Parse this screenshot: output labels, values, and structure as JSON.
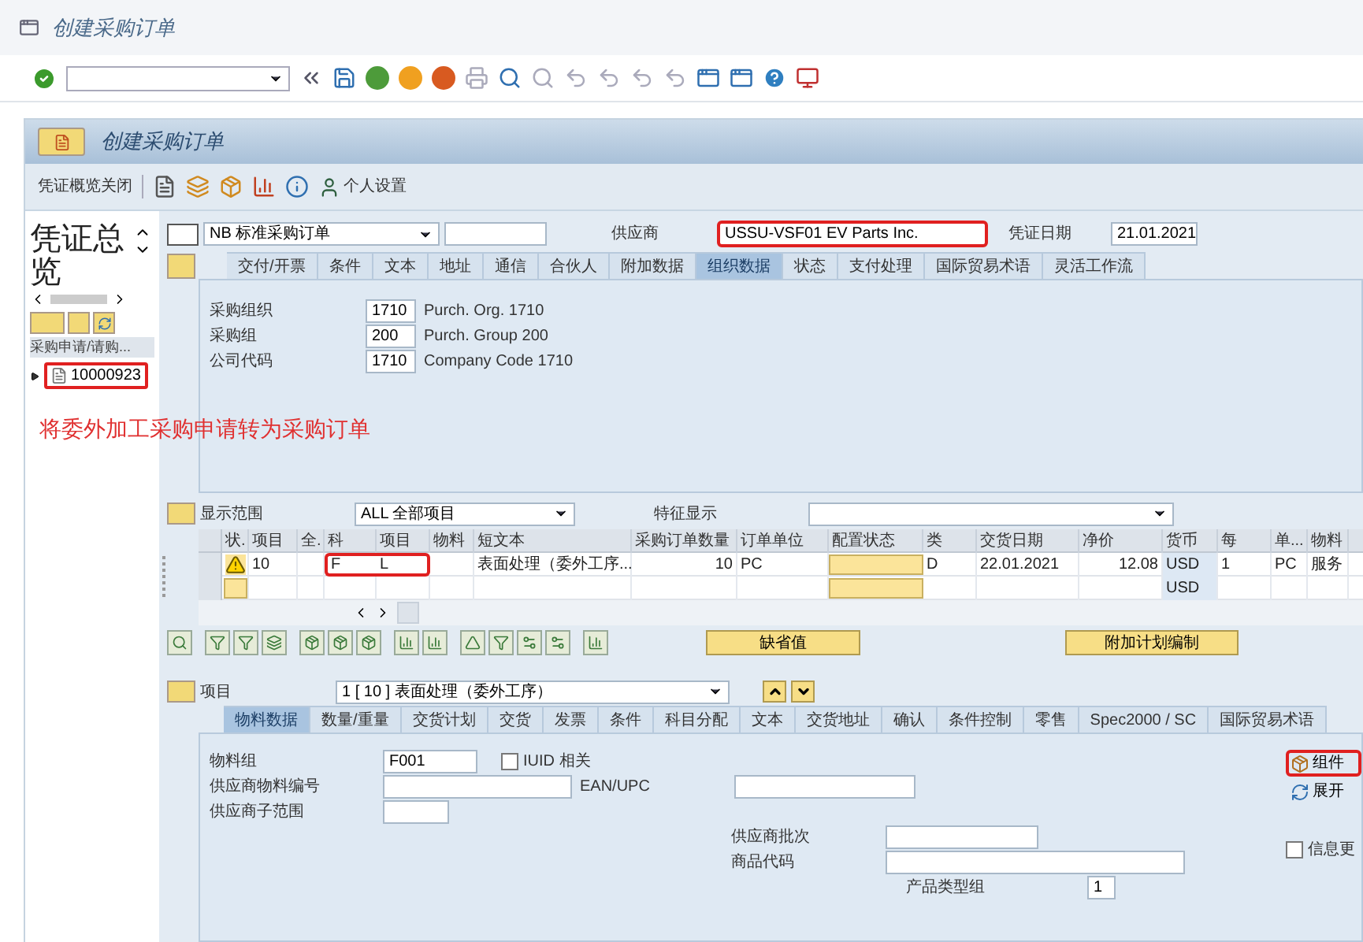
{
  "window": {
    "title": "创建采购订单"
  },
  "screen_title": "创建采购订单",
  "app_toolbar": {
    "close_overview": "凭证概览关闭",
    "personal_settings": "个人设置"
  },
  "overview": {
    "title": "凭证总览",
    "column": "采购申请/请购...",
    "items": [
      {
        "label": "10000923",
        "highlighted": true
      }
    ]
  },
  "annotation": "将委外加工采购申请转为采购订单",
  "header": {
    "doc_type": "NB 标准采购订单",
    "vendor_label": "供应商",
    "vendor": "USSU-VSF01 EV Parts Inc.",
    "vendor_highlighted": true,
    "date_label": "凭证日期",
    "date": "21.01.2021",
    "tabs": [
      {
        "label": "交付/开票",
        "selected": false
      },
      {
        "label": "条件",
        "selected": false
      },
      {
        "label": "文本",
        "selected": false
      },
      {
        "label": "地址",
        "selected": false
      },
      {
        "label": "通信",
        "selected": false
      },
      {
        "label": "合伙人",
        "selected": false
      },
      {
        "label": "附加数据",
        "selected": false
      },
      {
        "label": "组织数据",
        "selected": true
      },
      {
        "label": "状态",
        "selected": false
      },
      {
        "label": "支付处理",
        "selected": false
      },
      {
        "label": "国际贸易术语",
        "selected": false
      },
      {
        "label": "灵活工作流",
        "selected": false
      }
    ],
    "fields": [
      {
        "label": "采购组织",
        "value": "1710",
        "text": "Purch. Org. 1710"
      },
      {
        "label": "采购组",
        "value": "200",
        "text": "Purch. Group 200"
      },
      {
        "label": "公司代码",
        "value": "1710",
        "text": "Company Code 1710"
      }
    ]
  },
  "items": {
    "range_label": "显示范围",
    "range": "ALL 全部项目",
    "feature_label": "特征显示",
    "columns": [
      "状.",
      "项目",
      "全.",
      "科",
      "项目",
      "物料",
      "短文本",
      "采购订单数量",
      "订单单位",
      "配置状态",
      "类",
      "交货日期",
      "净价",
      "货币",
      "每",
      "单...",
      "物料"
    ],
    "rows": [
      {
        "warning": true,
        "highlighted": true,
        "item": "10",
        "acct_cat": "F",
        "item_cat": "L",
        "short_text": "表面处理（委外工序...",
        "qty": "10",
        "unit": "PC",
        "category": "D",
        "delivery_date": "22.01.2021",
        "net_price": "12.08",
        "currency": "USD",
        "per": "1",
        "order_unit": "PC",
        "material_group": "服务"
      },
      {
        "warning": false,
        "highlighted": false,
        "currency": "USD"
      }
    ]
  },
  "buttons": [
    "缺省值",
    "附加计划编制"
  ],
  "item_detail": {
    "label": "项目",
    "item": "1 [ 10 ] 表面处理（委外工序）",
    "tabs": [
      {
        "label": "物料数据",
        "selected": true
      },
      {
        "label": "数量/重量",
        "selected": false
      },
      {
        "label": "交货计划",
        "selected": false
      },
      {
        "label": "交货",
        "selected": false
      },
      {
        "label": "发票",
        "selected": false
      },
      {
        "label": "条件",
        "selected": false
      },
      {
        "label": "科目分配",
        "selected": false
      },
      {
        "label": "文本",
        "selected": false
      },
      {
        "label": "交货地址",
        "selected": false
      },
      {
        "label": "确认",
        "selected": false
      },
      {
        "label": "条件控制",
        "selected": false
      },
      {
        "label": "零售",
        "selected": false
      },
      {
        "label": "Spec2000 / SC",
        "selected": false
      },
      {
        "label": "国际贸易术语",
        "selected": false
      }
    ],
    "material_group_label": "物料组",
    "material_group": "F001",
    "iuid_label": "IUID 相关",
    "iuid_checked": false,
    "vendor_material_label": "供应商物料编号",
    "ean_label": "EAN/UPC",
    "vendor_subrange_label": "供应商子范围",
    "vendor_batch_label": "供应商批次",
    "commodity_code_label": "商品代码",
    "product_type_label": "产品类型组",
    "product_type": "1",
    "components_button": "组件",
    "components_highlighted": true,
    "explode_button": "展开",
    "info_update_label": "信息更",
    "info_update_checked": false
  }
}
